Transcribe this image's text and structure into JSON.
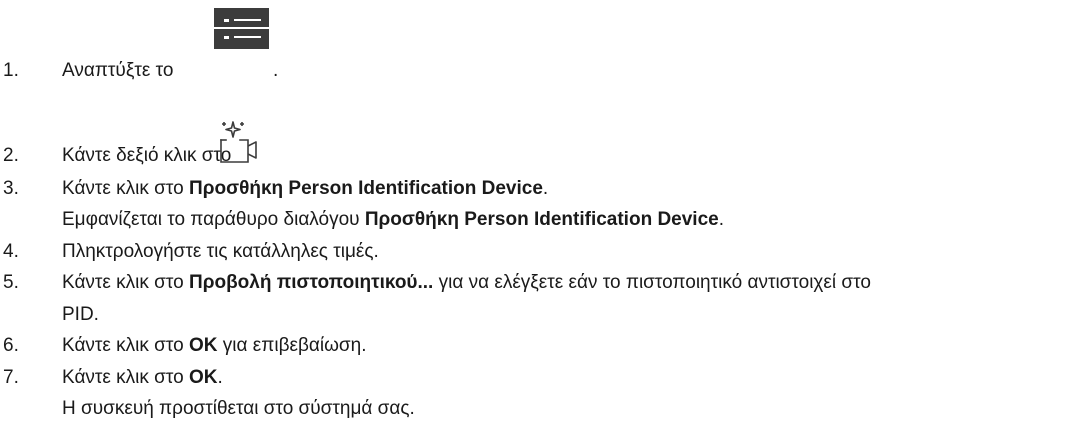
{
  "steps": [
    {
      "number": "1.",
      "text_before": "Αναπτύξτε το",
      "text_after": ".",
      "icon": "device-tree-list-icon"
    },
    {
      "number": "2.",
      "text_before": "Κάντε δεξιό κλικ στο",
      "icon": "person-identification-camera-icon"
    },
    {
      "number": "3.",
      "text_before": "Κάντε κλικ στο ",
      "bold": "Προσθήκη Person Identification Device",
      "text_after": ".",
      "result_before": "Εμφανίζεται το παράθυρο διαλόγου ",
      "result_bold": "Προσθήκη Person Identification Device",
      "result_after": "."
    },
    {
      "number": "4.",
      "text": "Πληκτρολογήστε τις κατάλληλες τιμές."
    },
    {
      "number": "5.",
      "text_before": "Κάντε κλικ στο ",
      "bold": "Προβολή πιστοποιητικού...",
      "text_after": " για να ελέγξετε εάν το πιστοποιητικό αντιστοιχεί στο",
      "continuation": "PID."
    },
    {
      "number": "6.",
      "text_before": "Κάντε κλικ στο ",
      "bold": "OK",
      "text_after": " για επιβεβαίωση."
    },
    {
      "number": "7.",
      "text_before": "Κάντε κλικ στο ",
      "bold": "OK",
      "text_after": ".",
      "result": "Η συσκευή προστίθεται στο σύστημά σας."
    }
  ],
  "colors": {
    "text": "#1a1a1a",
    "icon_dark": "#3c3c3c",
    "icon_line": "#ffffff"
  }
}
